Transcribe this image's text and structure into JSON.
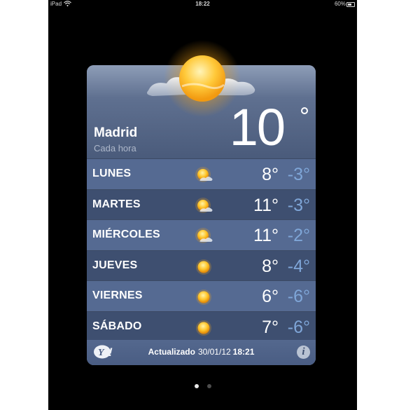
{
  "status_bar": {
    "device": "iPad",
    "time": "18:22",
    "battery": "60%",
    "icons": [
      "wifi-icon",
      "battery-icon"
    ]
  },
  "weather": {
    "city": "Madrid",
    "subtitle": "Cada hora",
    "current_temp": "10",
    "current_icon": "sun-cloud-icon",
    "forecast": [
      {
        "day": "LUNES",
        "hi": "8°",
        "lo": "-3°",
        "icon": "partly-cloudy-icon"
      },
      {
        "day": "MARTES",
        "hi": "11°",
        "lo": "-3°",
        "icon": "partly-cloudy-icon"
      },
      {
        "day": "MIÉRCOLES",
        "hi": "11°",
        "lo": "-2°",
        "icon": "partly-cloudy-icon"
      },
      {
        "day": "JUEVES",
        "hi": "8°",
        "lo": "-4°",
        "icon": "sun-icon"
      },
      {
        "day": "VIERNES",
        "hi": "6°",
        "lo": "-6°",
        "icon": "sun-icon"
      },
      {
        "day": "SÁBADO",
        "hi": "7°",
        "lo": "-6°",
        "icon": "sun-icon"
      }
    ],
    "footer": {
      "updated_label": "Actualizado",
      "updated_date": "30/01/12",
      "updated_time": "18:21",
      "logo": "Y!",
      "info_icon": "i"
    }
  },
  "page_indicator": {
    "pages": 2,
    "active": 1
  },
  "colors": {
    "panel": "#5c6d8c",
    "row_light": "#556a92",
    "row_dark": "#3e4f70",
    "low_temp": "#7fa6d8",
    "sun": "#f5b21a"
  }
}
